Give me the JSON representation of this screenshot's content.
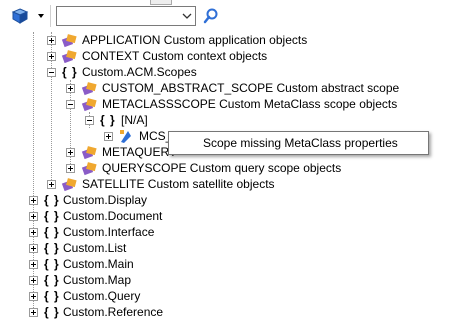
{
  "toolbar": {
    "search": {
      "value": "",
      "placeholder": ""
    },
    "icons": {
      "scope": "cube-icon",
      "dropdown": "dropdown-arrow-icon",
      "search": "search-icon"
    }
  },
  "tree": {
    "application": "APPLICATION Custom application objects",
    "context": "CONTEXT Custom context objects",
    "acm_scopes": "Custom.ACM.Scopes",
    "custom_abstract_scope": "CUSTOM_ABSTRACT_SCOPE Custom abstract scope",
    "metaclassscope": "METACLASSSCOPE Custom MetaClass scope objects",
    "na": "[N/A]",
    "mcs": "MCS_",
    "metaquery": "METAQUERY",
    "queryscope": "QUERYSCOPE Custom query scope objects",
    "satellite": "SATELLITE Custom satellite objects",
    "display": "Custom.Display",
    "document": "Custom.Document",
    "interface": "Custom.Interface",
    "list": "Custom.List",
    "main": "Custom.Main",
    "map": "Custom.Map",
    "query": "Custom.Query",
    "reference": "Custom.Reference",
    "braces": "{ }"
  },
  "tooltip": "Scope missing MetaClass properties",
  "colors": {
    "accent_blue": "#2f6fd6",
    "package_orange": "#f0a830",
    "package_purple": "#8a5cc7"
  }
}
